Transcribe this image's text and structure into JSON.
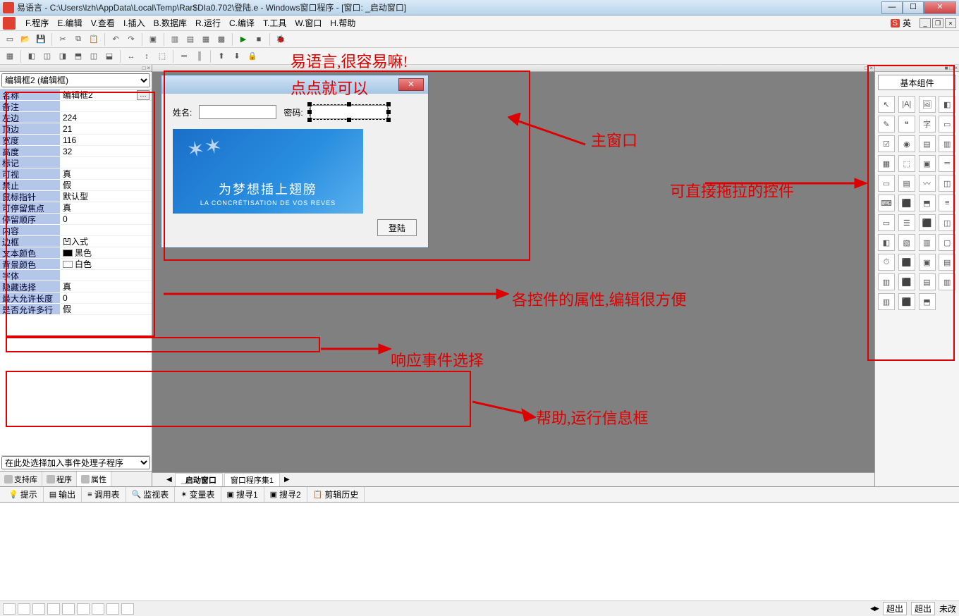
{
  "titlebar": {
    "title": "易语言 - C:\\Users\\lzh\\AppData\\Local\\Temp\\Rar$DIa0.702\\登陆.e - Windows窗口程序 - [窗口: _启动窗口]"
  },
  "menu": {
    "program": "F.程序",
    "edit": "E.编辑",
    "view": "V.查看",
    "insert": "I.插入",
    "database": "B.数据库",
    "run": "R.运行",
    "compile": "C.编译",
    "tool": "T.工具",
    "window": "W.窗口",
    "help": "H.帮助",
    "ime_mode": "英"
  },
  "left": {
    "combo_sel": "编辑框2 (编辑框)",
    "props": [
      {
        "k": "名称",
        "v": "编辑框2",
        "btn": true
      },
      {
        "k": "备注",
        "v": ""
      },
      {
        "k": "左边",
        "v": "224"
      },
      {
        "k": "顶边",
        "v": "21"
      },
      {
        "k": "宽度",
        "v": "116"
      },
      {
        "k": "高度",
        "v": "32"
      },
      {
        "k": "标记",
        "v": ""
      },
      {
        "k": "可视",
        "v": "真"
      },
      {
        "k": "禁止",
        "v": "假"
      },
      {
        "k": "鼠标指针",
        "v": "默认型"
      },
      {
        "k": "可停留焦点",
        "v": "真"
      },
      {
        "k": "  停留顺序",
        "v": "0"
      },
      {
        "k": "内容",
        "v": ""
      },
      {
        "k": "边框",
        "v": "凹入式"
      },
      {
        "k": "文本颜色",
        "v": "黑色",
        "swatch": "black"
      },
      {
        "k": "背景颜色",
        "v": "白色",
        "swatch": "white"
      },
      {
        "k": "字体",
        "v": ""
      },
      {
        "k": "隐藏选择",
        "v": "真"
      },
      {
        "k": "最大允许长度",
        "v": "0"
      },
      {
        "k": "是否允许多行",
        "v": "假"
      }
    ],
    "event_combo": "在此处选择加入事件处理子程序",
    "tabs": {
      "support": "支持库",
      "program": "程序",
      "property": "属性"
    }
  },
  "dialog": {
    "user_label": "姓名:",
    "pass_label": "密码:",
    "img_zh": "为梦想插上翅膀",
    "img_fr": "LA CONCRÉTISATION DE VOS REVES",
    "login_btn": "登陆"
  },
  "center_tabs": {
    "t1": "_启动窗口",
    "t2": "窗口程序集1"
  },
  "toolbox": {
    "title": "基本组件",
    "tools": [
      "↖",
      "|A|",
      "🖼",
      "◧",
      "✎",
      "❝",
      "字",
      "▭",
      "☑",
      "◉",
      "▤",
      "▥",
      "▦",
      "⬚",
      "▣",
      "═",
      "▭",
      "▤",
      "〰",
      "◫",
      "⌨",
      "⬛",
      "⬒",
      "≡",
      "▭",
      "☰",
      "⬛",
      "◫",
      "◧",
      "▧",
      "▥",
      "▢",
      "⏱",
      "⬛",
      "▣",
      "▤",
      "▥",
      "⬛",
      "▤",
      "▥",
      "▥",
      "⬛",
      "⬒"
    ]
  },
  "bottom_tabs": {
    "hint": "提示",
    "output": "输出",
    "call": "调用表",
    "watch": "监视表",
    "var": "变量表",
    "s1": "搜寻1",
    "s2": "搜寻2",
    "clip": "剪辑历史"
  },
  "statusbar": {
    "b1": "超出",
    "b2": "超出",
    "b3": "未改"
  },
  "annotations": {
    "a1": "易语言,很容易嘛!",
    "a2": "点点就可以",
    "a3": "主窗口",
    "a4": "可直接拖拉的控件",
    "a5": "各控件的属性,编辑很方便",
    "a6": "响应事件选择",
    "a7": "帮助,运行信息框"
  }
}
